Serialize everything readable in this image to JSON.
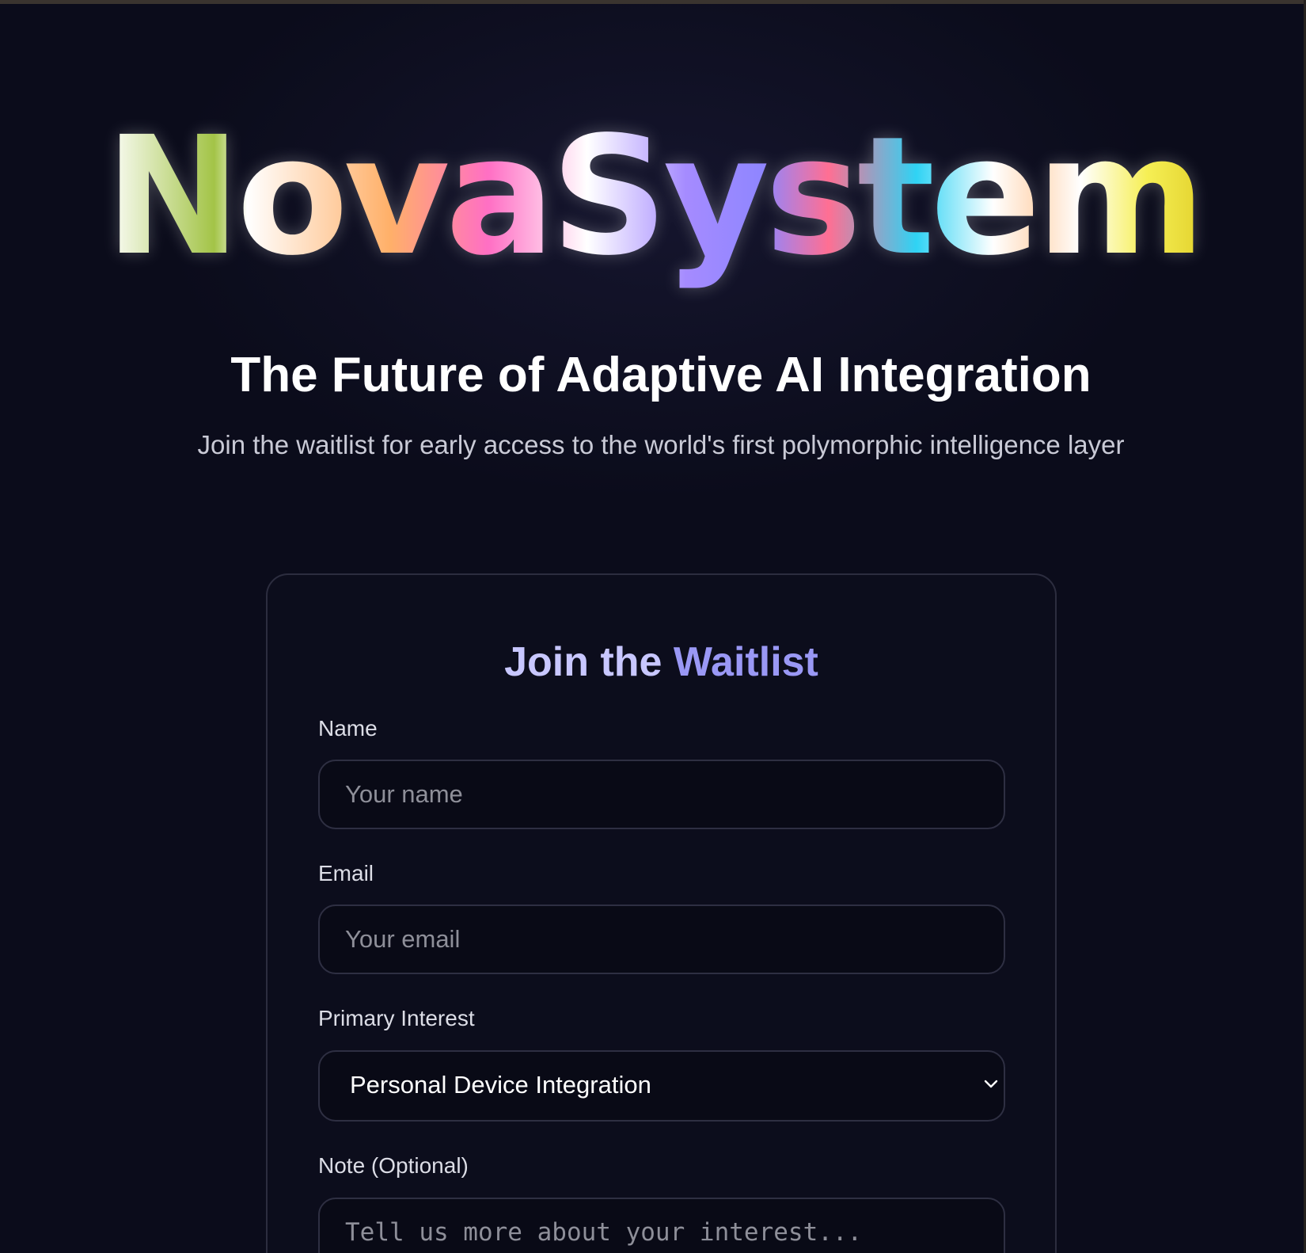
{
  "brand": {
    "logo_text": "NovaSystem"
  },
  "hero": {
    "headline": "The Future of Adaptive AI Integration",
    "subtext": "Join the waitlist for early access to the world's first polymorphic intelligence layer"
  },
  "waitlist_form": {
    "title_part1": "Join the",
    "title_part2": "Waitlist",
    "name_label": "Name",
    "name_placeholder": "Your name",
    "name_value": "",
    "email_label": "Email",
    "email_placeholder": "Your email",
    "email_value": "",
    "interest_label": "Primary Interest",
    "interest_selected": "Personal Device Integration",
    "note_label": "Note (Optional)",
    "note_placeholder": "Tell us more about your interest...",
    "note_value": ""
  },
  "icons": {
    "select_caret": "chevron-down-icon"
  },
  "colors": {
    "background": "#0b0c1b",
    "card_border": "#2c2d3f",
    "accent_light": "#c8c7ff",
    "accent": "#9a98f5",
    "muted_text": "#c9cad6",
    "placeholder": "#8e8f99"
  }
}
